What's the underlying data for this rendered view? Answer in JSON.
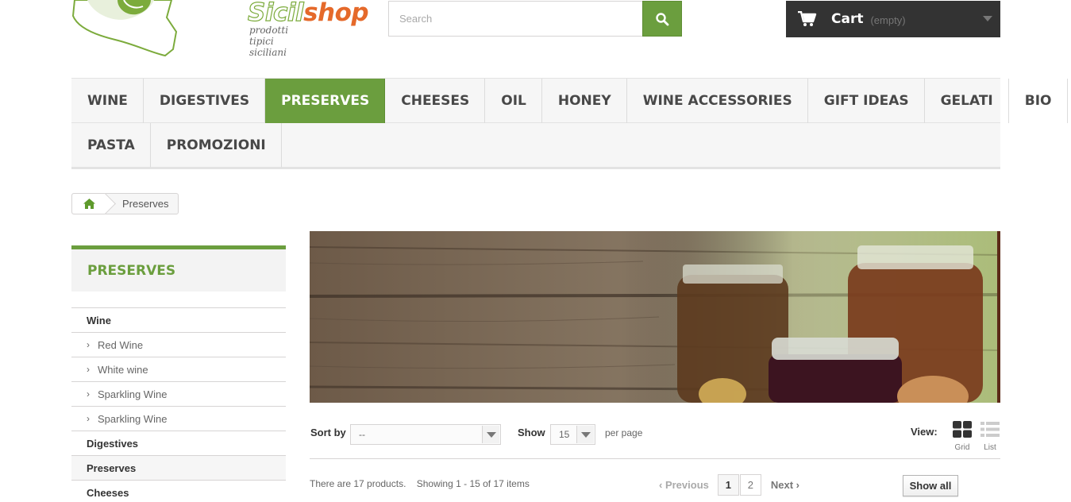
{
  "brand": {
    "name_part1": "Sicil",
    "name_part2": "shop",
    "tagline": "prodotti tipici siciliani"
  },
  "search": {
    "placeholder": "Search",
    "icon": "search-icon"
  },
  "cart": {
    "label": "Cart",
    "status": "(empty)",
    "icon": "shopping-cart-icon"
  },
  "menu": {
    "row1": [
      "WINE",
      "DIGESTIVES",
      "PRESERVES",
      "CHEESES",
      "OIL",
      "HONEY",
      "WINE ACCESSORIES",
      "GIFT IDEAS",
      "GELATI",
      "BIO"
    ],
    "row2": [
      "PASTA",
      "PROMOZIONI"
    ],
    "active": "PRESERVES"
  },
  "breadcrumb": {
    "home_icon": "home-icon",
    "current": "Preserves"
  },
  "sidebar": {
    "title": "PRESERVES",
    "items": [
      {
        "label": "Wine",
        "level": 0
      },
      {
        "label": "Red Wine",
        "level": 1
      },
      {
        "label": "White wine",
        "level": 1
      },
      {
        "label": "Sparkling Wine",
        "level": 1
      },
      {
        "label": "Sparkling Wine",
        "level": 1
      },
      {
        "label": "Digestives",
        "level": 0
      },
      {
        "label": "Preserves",
        "level": 0
      },
      {
        "label": "Cheeses",
        "level": 0
      }
    ]
  },
  "listing": {
    "sort_label": "Sort by",
    "sort_value": "--",
    "show_label": "Show",
    "show_value": "15",
    "per_page": "per page",
    "view_label": "View:",
    "view_grid": "Grid",
    "view_list": "List",
    "count_text": "There are 17 products.",
    "showing_text": "Showing 1 - 15 of 17 items",
    "previous": "Previous",
    "next": "Next",
    "pages": [
      "1",
      "2"
    ],
    "current_page": "1",
    "show_all": "Show all"
  },
  "colors": {
    "accent_green": "#6b9e3e",
    "cart_bg": "#333333",
    "brand_orange": "#e5692a"
  }
}
